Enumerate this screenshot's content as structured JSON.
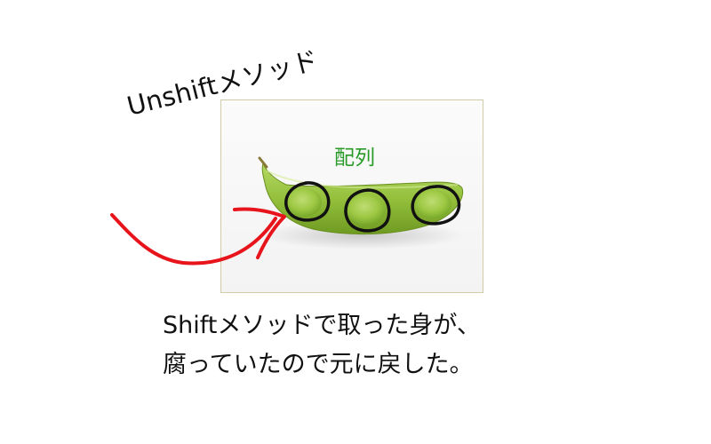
{
  "diagram": {
    "rotated_label": "Unshiftメソッド",
    "box_label": "配列",
    "caption_lines": [
      "Shiftメソッドで取った身が、",
      "腐っていたので元に戻した。"
    ],
    "colors": {
      "box_label": "#2a9a2a",
      "arrow": "#e8141c",
      "circles": "#111111",
      "pod": "#8fbf3a",
      "frame_border": "#cfcca8"
    },
    "icons": {
      "image": "edamame-pod-image",
      "arrow": "red-hand-drawn-arrow-icon",
      "circles": "black-hand-drawn-circle-icon"
    }
  }
}
